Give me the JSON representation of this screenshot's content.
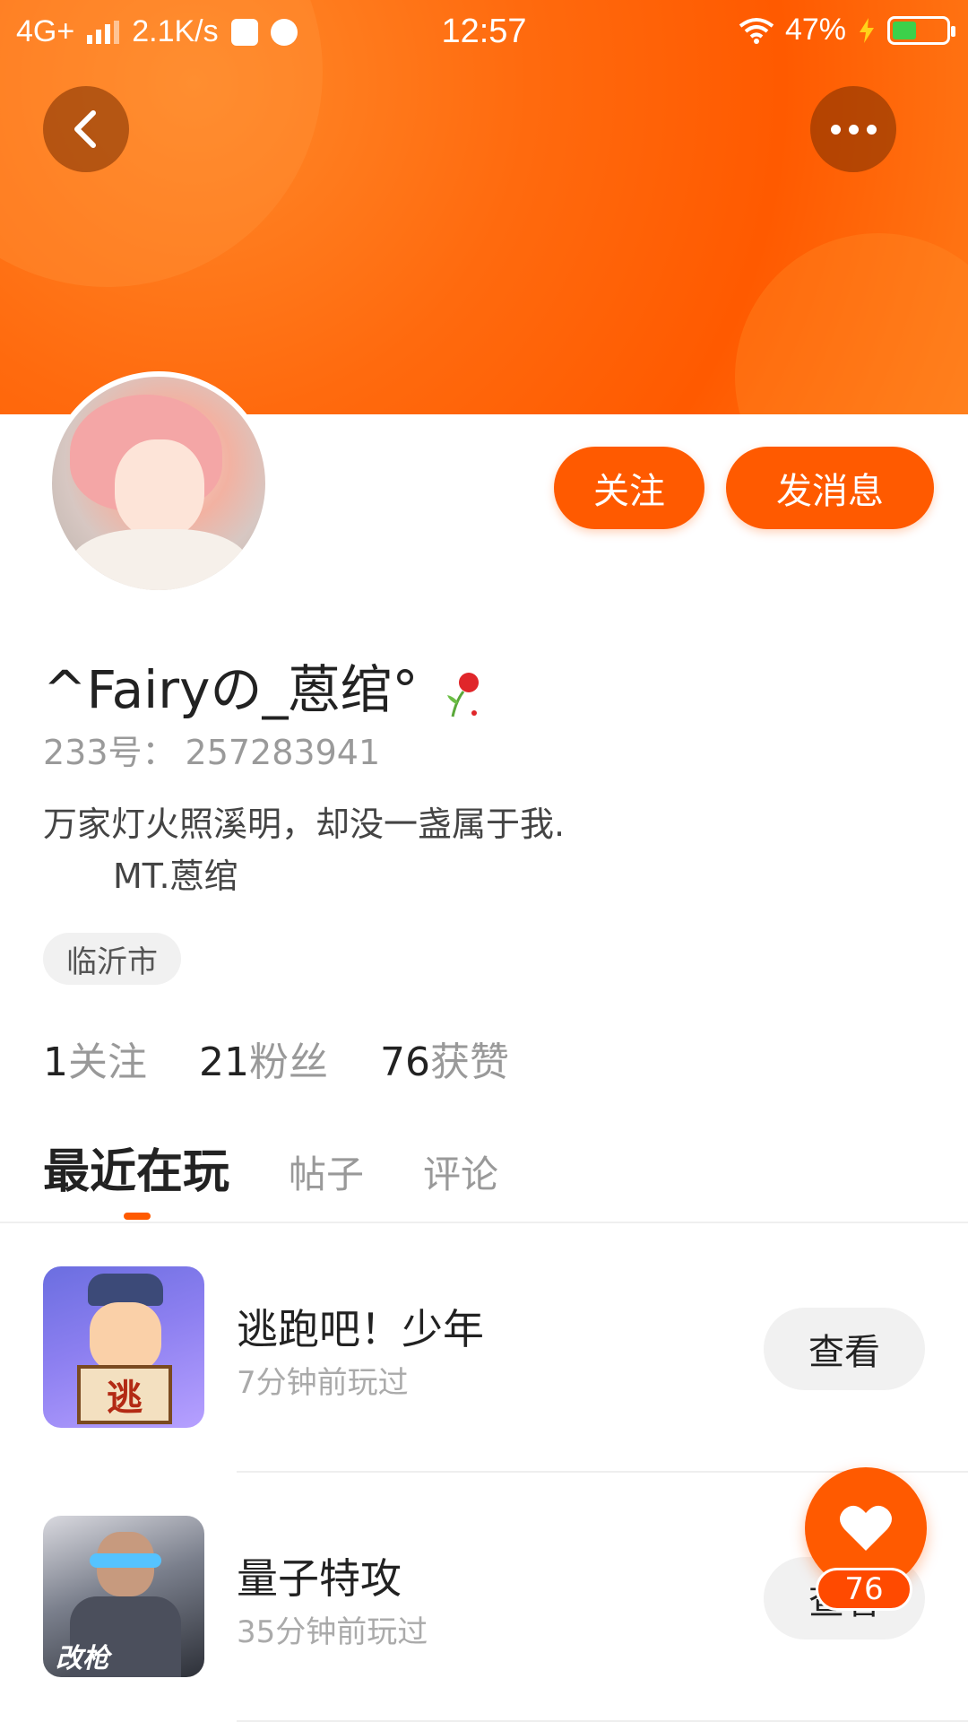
{
  "status_bar": {
    "network": "4G+",
    "speed": "2.1K/s",
    "time": "12:57",
    "battery": "47%",
    "battery_level": 0.47
  },
  "header": {
    "back_icon": "chevron-left-icon",
    "more_icon": "more-dots-icon"
  },
  "profile": {
    "username": "^Fairyの_蒽绾°",
    "uid_label": "233号：",
    "uid": "257283941",
    "bio_line1": "万家灯火照溪明，却没一盏属于我.",
    "bio_line2": "MT.蒽绾",
    "location": "临沂市",
    "follow_label": "关注",
    "message_label": "发消息"
  },
  "stats": [
    {
      "value": "1",
      "label": "关注"
    },
    {
      "value": "21",
      "label": "粉丝"
    },
    {
      "value": "76",
      "label": "获赞"
    }
  ],
  "tabs": [
    {
      "label": "最近在玩",
      "active": true
    },
    {
      "label": "帖子",
      "active": false
    },
    {
      "label": "评论",
      "active": false
    }
  ],
  "games": [
    {
      "title": "逃跑吧！少年",
      "subtitle": "7分钟前玩过",
      "button": "查看",
      "icon_text": "逃"
    },
    {
      "title": "量子特攻",
      "subtitle": "35分钟前玩过",
      "button": "查看",
      "icon_text": "改枪"
    }
  ],
  "like": {
    "count": "76"
  },
  "colors": {
    "accent": "#ff5a00",
    "banner": "#ff6a0e"
  }
}
